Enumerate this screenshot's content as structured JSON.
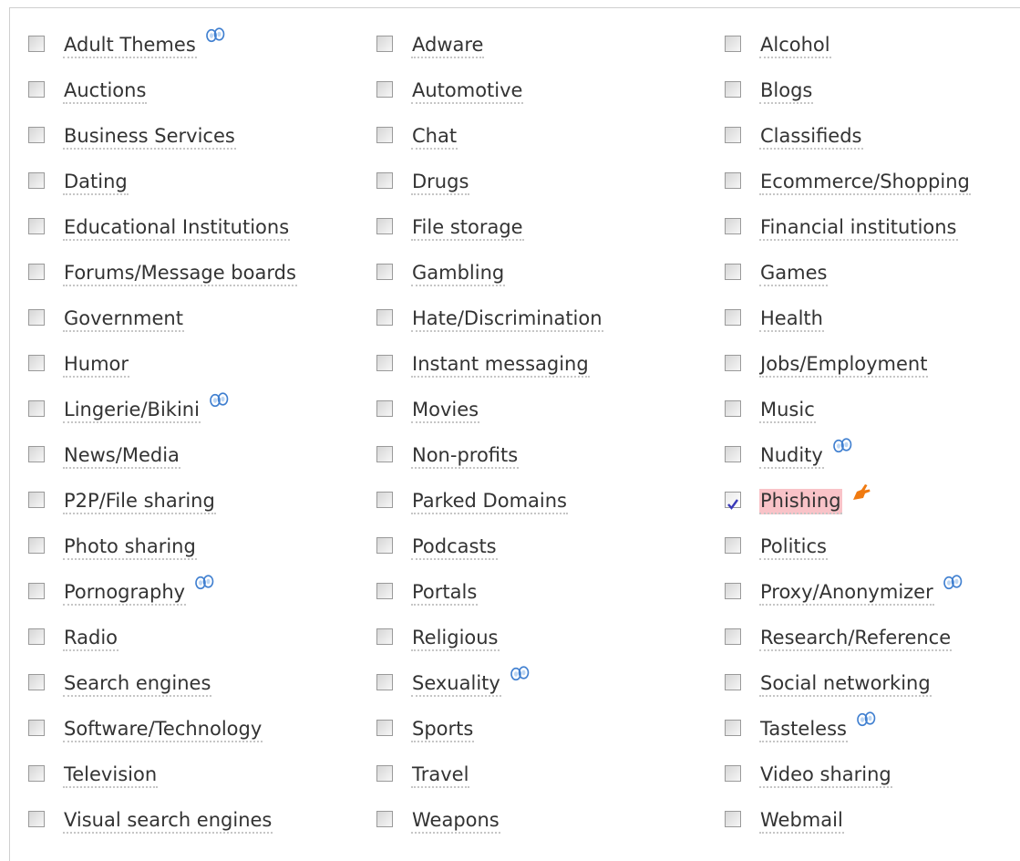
{
  "categories": [
    [
      {
        "label": "Adult Themes",
        "checked": false,
        "icon": "binoculars-icon"
      },
      {
        "label": "Auctions",
        "checked": false
      },
      {
        "label": "Business Services",
        "checked": false
      },
      {
        "label": "Dating",
        "checked": false
      },
      {
        "label": "Educational Institutions",
        "checked": false
      },
      {
        "label": "Forums/Message boards",
        "checked": false
      },
      {
        "label": "Government",
        "checked": false
      },
      {
        "label": "Humor",
        "checked": false
      },
      {
        "label": "Lingerie/Bikini",
        "checked": false,
        "icon": "binoculars-icon"
      },
      {
        "label": "News/Media",
        "checked": false
      },
      {
        "label": "P2P/File sharing",
        "checked": false
      },
      {
        "label": "Photo sharing",
        "checked": false
      },
      {
        "label": "Pornography",
        "checked": false,
        "icon": "binoculars-icon"
      },
      {
        "label": "Radio",
        "checked": false
      },
      {
        "label": "Search engines",
        "checked": false
      },
      {
        "label": "Software/Technology",
        "checked": false
      },
      {
        "label": "Television",
        "checked": false
      },
      {
        "label": "Visual search engines",
        "checked": false
      }
    ],
    [
      {
        "label": "Adware",
        "checked": false
      },
      {
        "label": "Automotive",
        "checked": false
      },
      {
        "label": "Chat",
        "checked": false
      },
      {
        "label": "Drugs",
        "checked": false
      },
      {
        "label": "File storage",
        "checked": false
      },
      {
        "label": "Gambling",
        "checked": false
      },
      {
        "label": "Hate/Discrimination",
        "checked": false
      },
      {
        "label": "Instant messaging",
        "checked": false
      },
      {
        "label": "Movies",
        "checked": false
      },
      {
        "label": "Non-profits",
        "checked": false
      },
      {
        "label": "Parked Domains",
        "checked": false
      },
      {
        "label": "Podcasts",
        "checked": false
      },
      {
        "label": "Portals",
        "checked": false
      },
      {
        "label": "Religious",
        "checked": false
      },
      {
        "label": "Sexuality",
        "checked": false,
        "icon": "binoculars-icon"
      },
      {
        "label": "Sports",
        "checked": false
      },
      {
        "label": "Travel",
        "checked": false
      },
      {
        "label": "Weapons",
        "checked": false
      }
    ],
    [
      {
        "label": "Alcohol",
        "checked": false
      },
      {
        "label": "Blogs",
        "checked": false
      },
      {
        "label": "Classifieds",
        "checked": false
      },
      {
        "label": "Ecommerce/Shopping",
        "checked": false
      },
      {
        "label": "Financial institutions",
        "checked": false
      },
      {
        "label": "Games",
        "checked": false
      },
      {
        "label": "Health",
        "checked": false
      },
      {
        "label": "Jobs/Employment",
        "checked": false
      },
      {
        "label": "Music",
        "checked": false
      },
      {
        "label": "Nudity",
        "checked": false,
        "icon": "binoculars-icon"
      },
      {
        "label": "Phishing",
        "checked": true,
        "highlighted": true,
        "icon": "hand-pointer-icon"
      },
      {
        "label": "Politics",
        "checked": false
      },
      {
        "label": "Proxy/Anonymizer",
        "checked": false,
        "icon": "binoculars-icon"
      },
      {
        "label": "Research/Reference",
        "checked": false
      },
      {
        "label": "Social networking",
        "checked": false
      },
      {
        "label": "Tasteless",
        "checked": false,
        "icon": "binoculars-icon"
      },
      {
        "label": "Video sharing",
        "checked": false
      },
      {
        "label": "Webmail",
        "checked": false
      }
    ]
  ],
  "colors": {
    "highlight": "#f9c3c8",
    "check": "#3a3ab8",
    "binoculars": "#3f7fd0",
    "hand": "#f07a10"
  }
}
